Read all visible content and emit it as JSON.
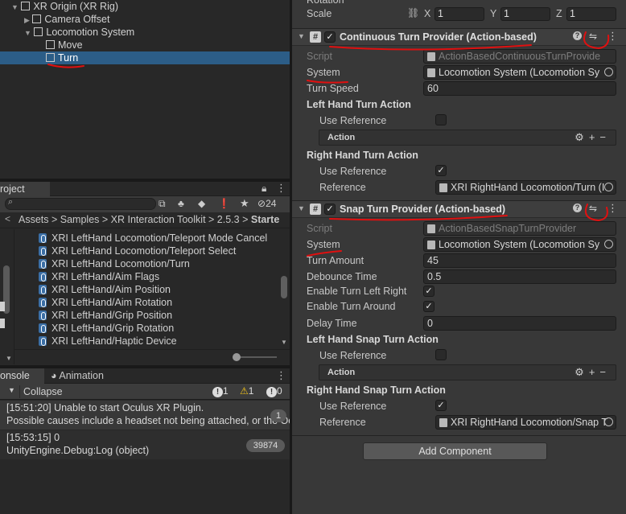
{
  "hierarchy": {
    "items": [
      {
        "label": "XR Origin (XR Rig)",
        "expanded": true
      },
      {
        "label": "Camera Offset",
        "expanded": false
      },
      {
        "label": "Locomotion System",
        "expanded": true
      },
      {
        "label": "Move"
      },
      {
        "label": "Turn",
        "selected": true
      }
    ]
  },
  "project": {
    "tab_label": "roject",
    "hidden_count": "24",
    "breadcrumb": [
      "Assets",
      "Samples",
      "XR Interaction Toolkit",
      "2.5.3",
      "Starte"
    ],
    "items": [
      "XRI LeftHand Locomotion/Teleport Mode Cancel",
      "XRI LeftHand Locomotion/Teleport Select",
      "XRI LeftHand Locomotion/Turn",
      "XRI LeftHand/Aim Flags",
      "XRI LeftHand/Aim Position",
      "XRI LeftHand/Aim Rotation",
      "XRI LeftHand/Grip Position",
      "XRI LeftHand/Grip Rotation",
      "XRI LeftHand/Haptic Device"
    ]
  },
  "console": {
    "tab_label": "onsole",
    "animation_tab_label": "Animation",
    "collapse_label": "Collapse",
    "info_count": "1",
    "warn_count": "1",
    "error_count": "0",
    "messages": [
      {
        "line1": "[15:51:20] Unable to start Oculus XR Plugin.",
        "line2": "Possible causes include a headset not being attached, or the Oc",
        "count": "1"
      },
      {
        "line1": "[15:53:15] 0",
        "line2": "UnityEngine.Debug:Log (object)",
        "count": "39874"
      }
    ]
  },
  "transform": {
    "rotation_label": "Rotation",
    "scale_label": "Scale",
    "scale": {
      "x": "1",
      "y": "1",
      "z": "1"
    },
    "axis_x": "X",
    "axis_y": "Y",
    "axis_z": "Z"
  },
  "continuous": {
    "title": "Continuous Turn Provider (Action-based)",
    "script_label": "Script",
    "script_value": "ActionBasedContinuousTurnProvide",
    "system_label": "System",
    "system_value": "Locomotion System (Locomotion Sy",
    "turn_speed_label": "Turn Speed",
    "turn_speed_value": "60",
    "left_hand_label": "Left Hand Turn Action",
    "use_reference_label": "Use Reference",
    "action_label": "Action",
    "right_hand_label": "Right Hand Turn Action",
    "right_use_reference_label": "Use Reference",
    "reference_label": "Reference",
    "reference_value": "XRI RightHand Locomotion/Turn (I"
  },
  "snap": {
    "title": "Snap Turn Provider (Action-based)",
    "script_label": "Script",
    "script_value": "ActionBasedSnapTurnProvider",
    "system_label": "System",
    "system_value": "Locomotion System (Locomotion Sy",
    "turn_amount_label": "Turn Amount",
    "turn_amount_value": "45",
    "debounce_label": "Debounce Time",
    "debounce_value": "0.5",
    "enable_left_right_label": "Enable Turn Left Right",
    "enable_around_label": "Enable Turn Around",
    "delay_label": "Delay Time",
    "delay_value": "0",
    "left_hand_label": "Left Hand Snap Turn Action",
    "use_reference_label": "Use Reference",
    "action_label": "Action",
    "right_hand_label": "Right Hand Snap Turn Action",
    "right_use_reference_label": "Use Reference",
    "reference_label": "Reference",
    "reference_value": "XRI RightHand Locomotion/Snap T"
  },
  "add_component_label": "Add Component",
  "colors": {
    "selection": "#2c5d87",
    "annotation": "#e01010"
  }
}
